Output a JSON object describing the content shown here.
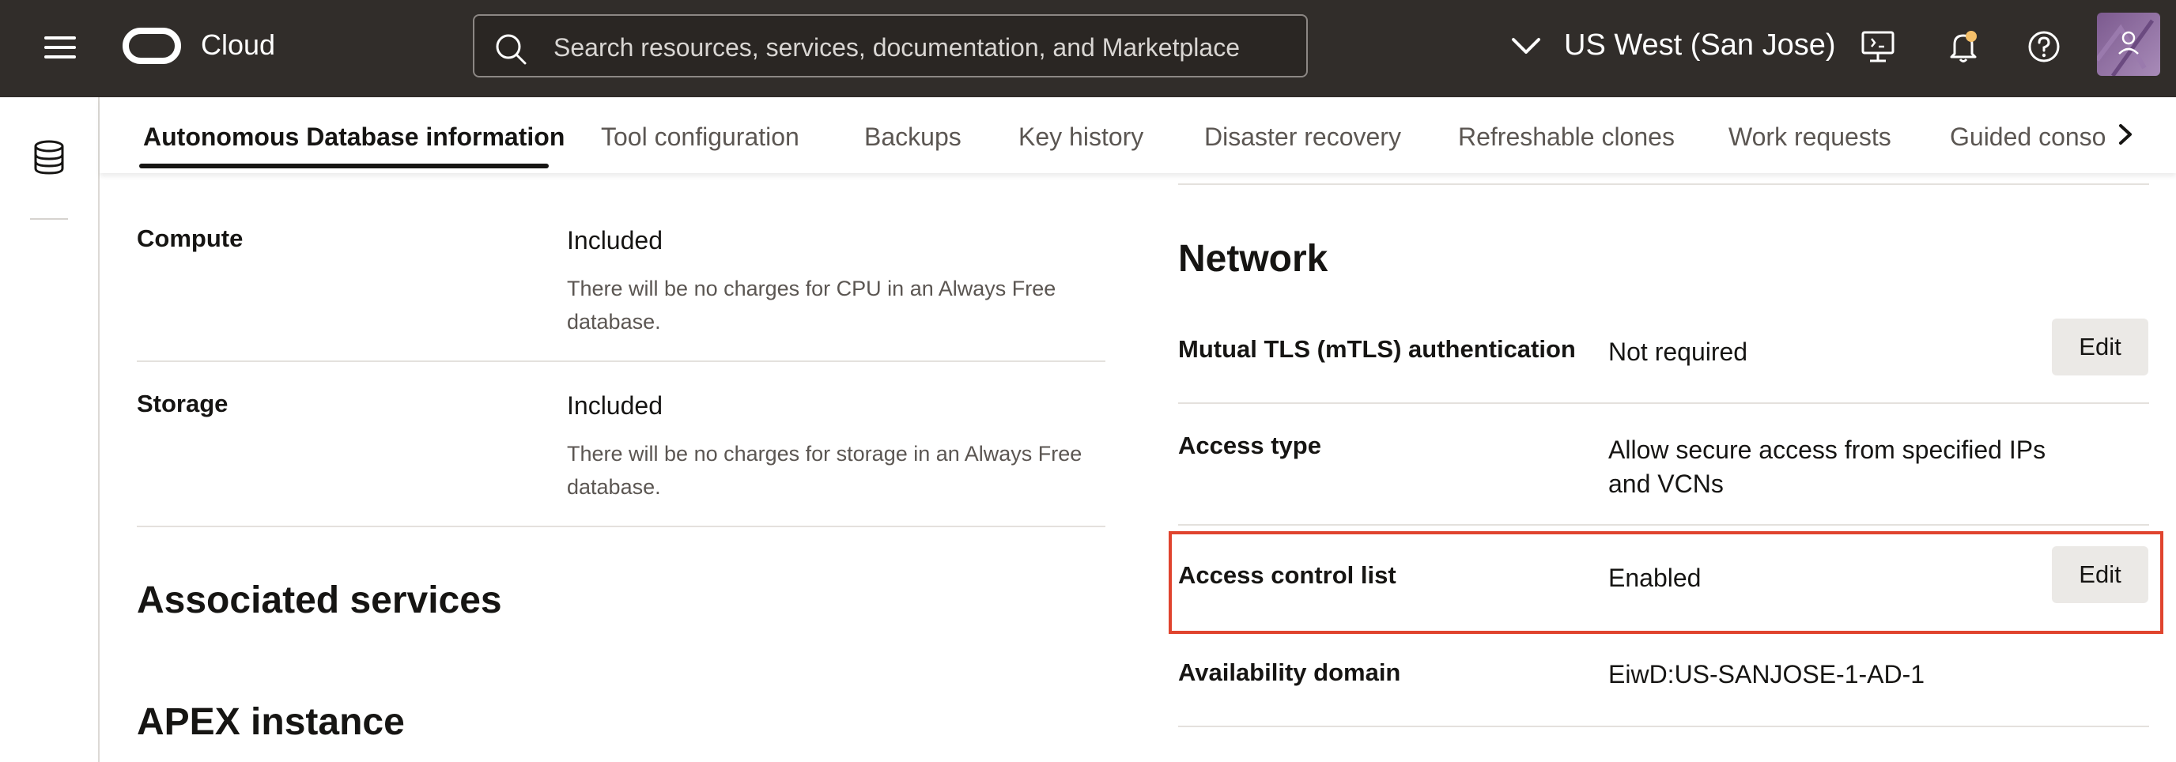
{
  "header": {
    "app_name": "Cloud",
    "search_placeholder": "Search resources, services, documentation, and Marketplace",
    "region": "US West (San Jose)"
  },
  "tabs": [
    {
      "label": "Autonomous Database information",
      "active": true
    },
    {
      "label": "Tool configuration"
    },
    {
      "label": "Backups"
    },
    {
      "label": "Key history"
    },
    {
      "label": "Disaster recovery"
    },
    {
      "label": "Refreshable clones"
    },
    {
      "label": "Work requests"
    },
    {
      "label": "Guided conso"
    }
  ],
  "left": {
    "compute": {
      "label": "Compute",
      "value": "Included",
      "description": "There will be no charges for CPU in an Always Free database."
    },
    "storage": {
      "label": "Storage",
      "value": "Included",
      "description": "There will be no charges for storage in an Always Free database."
    },
    "associated_services_title": "Associated services",
    "apex_title": "APEX instance"
  },
  "network": {
    "title": "Network",
    "rows": [
      {
        "label": "Mutual TLS (mTLS) authentication",
        "value": "Not required",
        "action": "Edit"
      },
      {
        "label": "Access type",
        "value": "Allow secure access from specified IPs and VCNs"
      },
      {
        "label": "Access control list",
        "value": "Enabled",
        "action": "Edit",
        "highlighted": true
      },
      {
        "label": "Availability domain",
        "value": "EiwD:US-SANJOSE-1-AD-1"
      }
    ]
  },
  "colors": {
    "header_bg": "#312d2a",
    "highlight_border": "#e0442e",
    "edit_button_bg": "#ebe9e6"
  }
}
